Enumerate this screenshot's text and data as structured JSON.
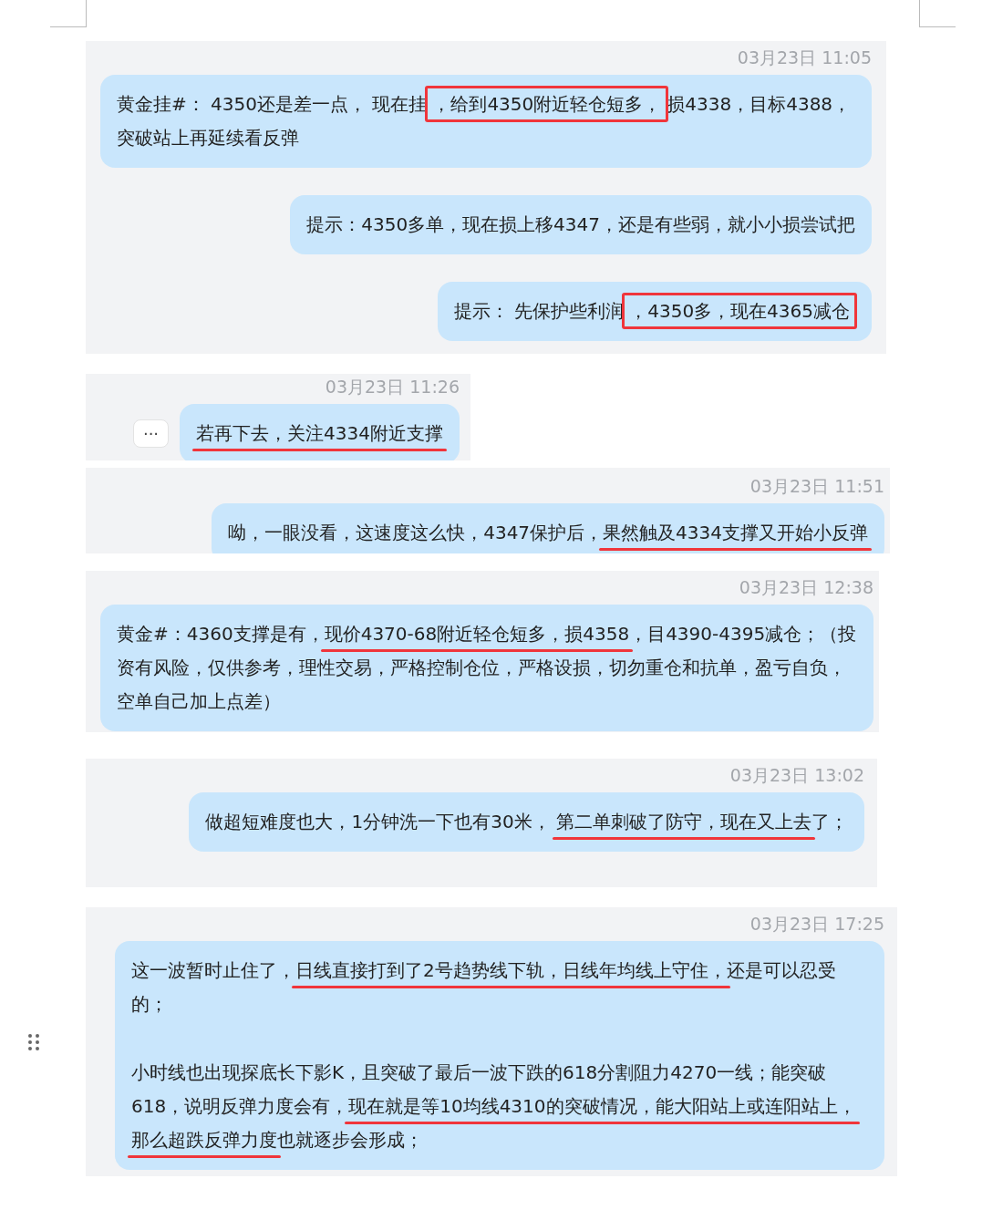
{
  "panels": [
    {
      "time": "03月23日 11:05",
      "bubbles": [
        {
          "paragraphs": [
            [
              {
                "text": "黄金挂#：  4350还是差一点， 现在挂"
              },
              {
                "text": "，给到4350附近轻仓短多，",
                "boxed": true
              },
              {
                "text": "损4338，目标4388，突破站上再延续看反弹"
              }
            ]
          ]
        },
        {
          "paragraphs": [
            [
              {
                "text": "提示：4350多单，现在损上移4347，还是有些弱，就小小损尝试把"
              }
            ]
          ]
        },
        {
          "paragraphs": [
            [
              {
                "text": "提示：  先保护些利润"
              },
              {
                "text": "，4350多，现在4365减仓",
                "boxed": true
              }
            ]
          ]
        }
      ]
    },
    {
      "time": "03月23日 11:26",
      "more_button": "···",
      "bubbles": [
        {
          "paragraphs": [
            [
              {
                "text": "若再下去，关注4334附近支撑",
                "underlined": true
              }
            ]
          ]
        }
      ]
    },
    {
      "time": "03月23日 11:51",
      "bubbles": [
        {
          "paragraphs": [
            [
              {
                "text": "呦，一眼没看，这速度这么快，4347保护后，"
              },
              {
                "text": "果然触及4334支撑又开始小反弹",
                "underlined": true
              }
            ]
          ]
        }
      ]
    },
    {
      "time": "03月23日 12:38",
      "bubbles": [
        {
          "paragraphs": [
            [
              {
                "text": "黄金#：4360支撑是有，"
              },
              {
                "text": "现价4370-68附近轻仓短多，损4358",
                "underlined": true
              },
              {
                "text": "，目4390-4395减仓；（投资有风险，仅供参考，理性交易，严格控制仓位，严格设损，切勿重仓和抗单，盈亏自负，空单自己加上点差）"
              }
            ]
          ]
        }
      ]
    },
    {
      "time": "03月23日 13:02",
      "bubbles": [
        {
          "paragraphs": [
            [
              {
                "text": "做超短难度也大，1分钟洗一下也有30米， "
              },
              {
                "text": "第二单刺破了防守，现在又上去",
                "underlined": true
              },
              {
                "text": "了；"
              }
            ]
          ]
        }
      ]
    },
    {
      "time": "03月23日 17:25",
      "bubbles": [
        {
          "paragraphs": [
            [
              {
                "text": "这一波暂时止住了，"
              },
              {
                "text": "日线直接打到了2号趋势线下轨，日线年均线上守住，",
                "underlined": true
              },
              {
                "text": "还是可以忍受的；"
              }
            ],
            [
              {
                "text": "小时线也出现探底长下影K，且突破了最后一波下跌的618分割阻力4270一线；能突破618，说明反弹力度会有，"
              },
              {
                "text": "现在就是等10均线4310的突破情况，能大阳站上或连阳站上，那么超跌反弹力度",
                "underlined": true
              },
              {
                "text": "也就逐步会形成；"
              }
            ]
          ]
        }
      ]
    }
  ]
}
